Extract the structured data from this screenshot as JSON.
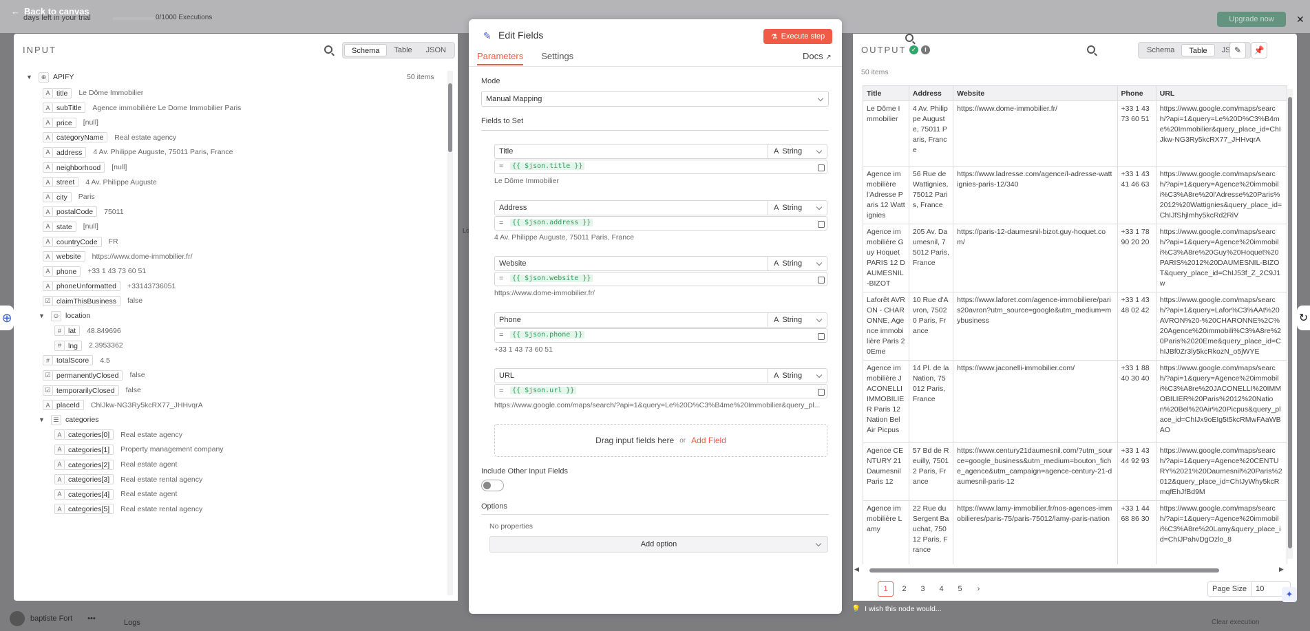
{
  "background": {
    "back_label": "Back to canvas",
    "trial_text": "days left in your trial",
    "exec_count": "0/1000 Executions",
    "upgrade_label": "Upgrade now",
    "user_name": "baptiste Fort",
    "logs_label": "Logs",
    "clear_label": "Clear execution",
    "fragment_left": "Lo"
  },
  "input": {
    "title": "INPUT",
    "view_tabs": [
      "Schema",
      "Table",
      "JSON"
    ],
    "active_view": "Schema",
    "root_name": "APIFY",
    "item_count": "50 items",
    "rows": [
      {
        "type": "A",
        "key": "title",
        "value": "Le Dôme Immobilier"
      },
      {
        "type": "A",
        "key": "subTitle",
        "value": "Agence immobilière Le Dome Immobilier Paris"
      },
      {
        "type": "A",
        "key": "price",
        "value": "[null]"
      },
      {
        "type": "A",
        "key": "categoryName",
        "value": "Real estate agency"
      },
      {
        "type": "A",
        "key": "address",
        "value": "4 Av. Philippe Auguste, 75011 Paris, France"
      },
      {
        "type": "A",
        "key": "neighborhood",
        "value": "[null]"
      },
      {
        "type": "A",
        "key": "street",
        "value": "4 Av. Philippe Auguste"
      },
      {
        "type": "A",
        "key": "city",
        "value": "Paris"
      },
      {
        "type": "A",
        "key": "postalCode",
        "value": "75011"
      },
      {
        "type": "A",
        "key": "state",
        "value": "[null]"
      },
      {
        "type": "A",
        "key": "countryCode",
        "value": "FR"
      },
      {
        "type": "A",
        "key": "website",
        "value": "https://www.dome-immobilier.fr/"
      },
      {
        "type": "A",
        "key": "phone",
        "value": "+33 1 43 73 60 51"
      },
      {
        "type": "A",
        "key": "phoneUnformatted",
        "value": "+33143736051"
      },
      {
        "type": "☑",
        "key": "claimThisBusiness",
        "value": "false"
      },
      {
        "type": "⊙",
        "key": "location",
        "value": "",
        "group": true
      },
      {
        "type": "#",
        "key": "lat",
        "value": "48.849696",
        "indent": 1
      },
      {
        "type": "#",
        "key": "lng",
        "value": "2.3953362",
        "indent": 1
      },
      {
        "type": "#",
        "key": "totalScore",
        "value": "4.5"
      },
      {
        "type": "☑",
        "key": "permanentlyClosed",
        "value": "false"
      },
      {
        "type": "☑",
        "key": "temporarilyClosed",
        "value": "false"
      },
      {
        "type": "A",
        "key": "placeId",
        "value": "ChIJkw-NG3Ry5kcRX77_JHHvqrA"
      },
      {
        "type": "☰",
        "key": "categories",
        "value": "",
        "group": true
      },
      {
        "type": "A",
        "key": "categories[0]",
        "value": "Real estate agency",
        "indent": 1
      },
      {
        "type": "A",
        "key": "categories[1]",
        "value": "Property management company",
        "indent": 1
      },
      {
        "type": "A",
        "key": "categories[2]",
        "value": "Real estate agent",
        "indent": 1
      },
      {
        "type": "A",
        "key": "categories[3]",
        "value": "Real estate rental agency",
        "indent": 1
      },
      {
        "type": "A",
        "key": "categories[4]",
        "value": "Real estate agent",
        "indent": 1
      },
      {
        "type": "A",
        "key": "categories[5]",
        "value": "Real estate rental agency",
        "indent": 1
      }
    ]
  },
  "editor": {
    "title": "Edit Fields",
    "execute_label": "Execute step",
    "tabs": [
      "Parameters",
      "Settings"
    ],
    "docs_label": "Docs",
    "mode_label": "Mode",
    "mode_value": "Manual Mapping",
    "fields_label": "Fields to Set",
    "fields": [
      {
        "name": "Title",
        "type": "String",
        "expr": "{{ $json.title }}",
        "preview": "Le Dôme Immobilier"
      },
      {
        "name": "Address",
        "type": "String",
        "expr": "{{ $json.address }}",
        "preview": "4 Av. Philippe Auguste, 75011 Paris, France"
      },
      {
        "name": "Website",
        "type": "String",
        "expr": "{{ $json.website }}",
        "preview": "https://www.dome-immobilier.fr/"
      },
      {
        "name": "Phone",
        "type": "String",
        "expr": "{{ $json.phone }}",
        "preview": "+33 1 43 73 60 51"
      },
      {
        "name": "URL",
        "type": "String",
        "expr": "{{ $json.url }}",
        "preview": "https://www.google.com/maps/search/?api=1&query=Le%20D%C3%B4me%20Immobilier&query_pl..."
      }
    ],
    "drop_text": "Drag input fields here",
    "drop_or": "or",
    "add_field_label": "Add Field",
    "include_label": "Include Other Input Fields",
    "options_label": "Options",
    "no_props": "No properties",
    "add_option_label": "Add option"
  },
  "output": {
    "title": "OUTPUT",
    "view_tabs": [
      "Schema",
      "Table",
      "JSON"
    ],
    "active_view": "Table",
    "item_count": "50 items",
    "columns": [
      "Title",
      "Address",
      "Website",
      "Phone",
      "URL"
    ],
    "rows": [
      [
        "Le Dôme Immobilier",
        "4 Av. Philippe Auguste, 75011 Paris, France",
        "https://www.dome-immobilier.fr/",
        "+33 1 43 73 60 51",
        "https://www.google.com/maps/search/?api=1&query=Le%20D%C3%B4me%20Immobilier&query_place_id=ChIJkw-NG3Ry5kcRX77_JHHvqrA"
      ],
      [
        "Agence immobilière l'Adresse Paris 12 Wattignies",
        "56 Rue de Wattignies, 75012 Paris, France",
        "https://www.ladresse.com/agence/l-adresse-wattignies-paris-12/340",
        "+33 1 43 41 46 63",
        "https://www.google.com/maps/search/?api=1&query=Agence%20immobili%C3%A8re%20l'Adresse%20Paris%2012%20Wattignies&query_place_id=ChIJfShjlmhy5kcRd2RiV"
      ],
      [
        "Agence immobilière Guy Hoquet PARIS 12 DAUMESNIL-BIZOT",
        "205 Av. Daumesnil, 75012 Paris, France",
        "https://paris-12-daumesnil-bizot.guy-hoquet.com/",
        "+33 1 78 90 20 20",
        "https://www.google.com/maps/search/?api=1&query=Agence%20immobili%C3%A8re%20Guy%20Hoquet%20PARIS%2012%20DAUMESNIL-BIZOT&query_place_id=ChIJ53f_Z_2C9J1w"
      ],
      [
        "Laforêt AVRON - CHARONNE, Agence immobilière Paris 20Eme",
        "10 Rue d'Avron, 75020 Paris, France",
        "https://www.laforet.com/agence-immobiliere/paris20avron?utm_source=google&utm_medium=mybusiness",
        "+33 1 43 48 02 42",
        "https://www.google.com/maps/search/?api=1&query=Lafor%C3%AAt%20AVRON%20-%20CHARONNE%2C%20Agence%20immobili%C3%A8re%20Paris%2020Eme&query_place_id=ChIJBf0Zr3ly5kcRkozN_o5jWYE"
      ],
      [
        "Agence immobilière JACONELLI IMMOBILIER Paris 12 Nation Bel Air Picpus",
        "14 Pl. de la Nation, 75012 Paris, France",
        "https://www.jaconelli-immobilier.com/",
        "+33 1 88 40 30 40",
        "https://www.google.com/maps/search/?api=1&query=Agence%20immobili%C3%A8re%20JACONELLI%20IMMOBILIER%20Paris%2012%20Nation%20Bel%20Air%20Picpus&query_place_id=ChIJx9oEIg5t5kcRMwFAaWBAO"
      ],
      [
        "Agence CENTURY 21 Daumesnil Paris 12",
        "57 Bd de Reuilly, 75012 Paris, France",
        "https://www.century21daumesnil.com/?utm_source=google_business&utm_medium=bouton_fiche_agence&utm_campaign=agence-century-21-daumesnil-paris-12",
        "+33 1 43 44 92 93",
        "https://www.google.com/maps/search/?api=1&query=Agence%20CENTURY%2021%20Daumesnil%20Paris%2012&query_place_id=ChIJyWhy5kcRmqfEhJfBd9M"
      ],
      [
        "Agence immobilière Lamy",
        "22 Rue du Sergent Bauchat, 75012 Paris, France",
        "https://www.lamy-immobilier.fr/nos-agences-immobilieres/paris-75/paris-75012/lamy-paris-nation",
        "+33 1 44 68 86 30",
        "https://www.google.com/maps/search/?api=1&query=Agence%20immobili%C3%A8re%20Lamy&query_place_id=ChIJPahvDgOzlo_8"
      ]
    ],
    "pages": [
      "1",
      "2",
      "3",
      "4",
      "5"
    ],
    "active_page": "1",
    "page_size_label": "Page Size",
    "page_size_value": "10",
    "wish_text": "I wish this node would..."
  }
}
